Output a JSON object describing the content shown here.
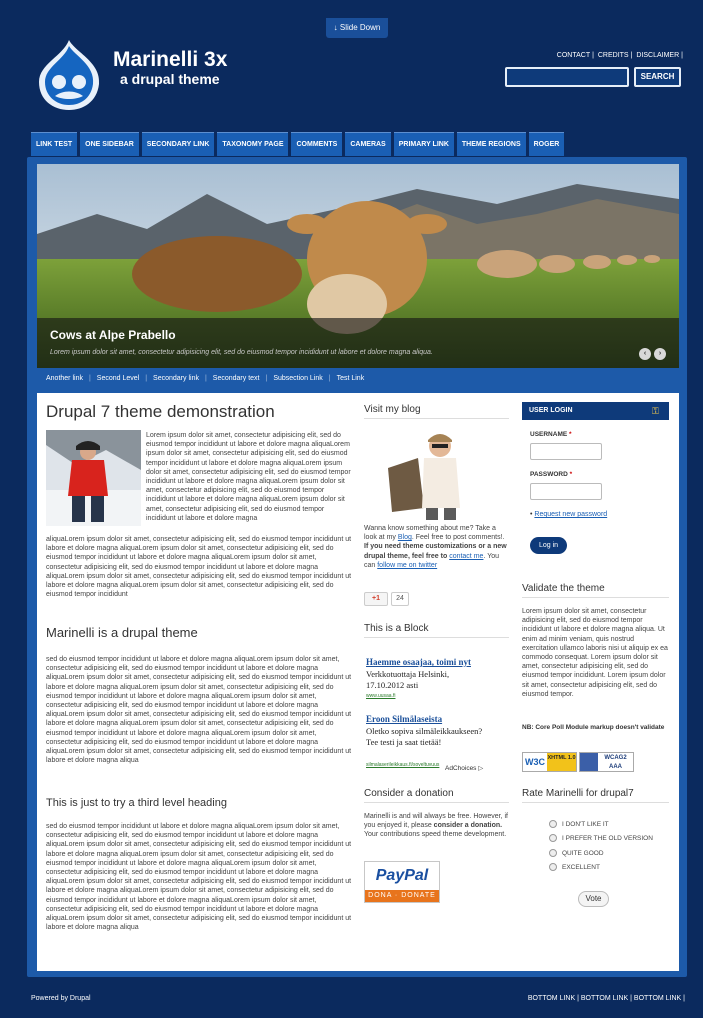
{
  "header": {
    "slide_down": "↓ Slide Down",
    "site_name": "Marinelli 3x",
    "site_slogan": "a drupal theme",
    "top_links": [
      "CONTACT",
      "CREDITS",
      "DISCLAIMER"
    ],
    "search_button": "SEARCH"
  },
  "primary_menu": [
    "LINK TEST",
    "ONE SIDEBAR",
    "SECONDARY LINK",
    "TAXONOMY PAGE",
    "COMMENTS",
    "CAMERAS",
    "PRIMARY LINK",
    "THEME REGIONS",
    "ROGER"
  ],
  "banner": {
    "title": "Cows at Alpe Prabello",
    "text": "Lorem ipsum dolor sit amet, consectetur adipisicing elit, sed do eiusmod tempor incididunt ut labore et dolore magna aliqua.",
    "prev": "‹",
    "next": "›"
  },
  "secondary_menu": [
    "Another link",
    "Second Level",
    "Secondary link",
    "Secondary text",
    "Subsection Link",
    "Test Link"
  ],
  "main": {
    "title": "Drupal 7 theme demonstration",
    "intro_wrap": "Lorem ipsum dolor sit amet, consectetur adipisicing elit, sed do eiusmod tempor incididunt ut labore et dolore magna aliquaLorem ipsum dolor sit amet, consectetur adipisicing elit, sed do eiusmod tempor incididunt ut labore et dolore magna aliquaLorem ipsum dolor sit amet, consectetur adipisicing elit, sed do eiusmod tempor incididunt ut labore et dolore magna aliquaLorem ipsum dolor sit amet, consectetur adipisicing elit, sed do eiusmod tempor incididunt ut labore et dolore magna aliquaLorem ipsum dolor sit amet, consectetur adipisicing elit, sed do eiusmod tempor incididunt ut labore et dolore magna",
    "intro_rest": "aliquaLorem ipsum dolor sit amet, consectetur adipisicing elit, sed do eiusmod tempor incididunt ut labore et dolore magna aliquaLorem ipsum dolor sit amet, consectetur adipisicing elit, sed do eiusmod tempor incididunt ut labore et dolore magna aliquaLorem ipsum dolor sit amet, consectetur adipisicing elit, sed do eiusmod tempor incididunt ut labore et dolore magna aliquaLorem ipsum dolor sit amet, consectetur adipisicing elit, sed do eiusmod tempor incididunt ut labore et dolore magna aliquaLorem ipsum dolor sit amet, consectetur adipisicing elit, sed do eiusmod tempor incididunt",
    "h2": "Marinelli is a drupal theme",
    "p2": "sed do eiusmod tempor incididunt ut labore et dolore magna aliquaLorem ipsum dolor sit amet, consectetur adipisicing elit, sed do eiusmod tempor incididunt ut labore et dolore magna aliquaLorem ipsum dolor sit amet, consectetur adipisicing elit, sed do eiusmod tempor incididunt ut labore et dolore magna aliquaLorem ipsum dolor sit amet, consectetur adipisicing elit, sed do eiusmod tempor incididunt ut labore et dolore magna aliquaLorem ipsum dolor sit amet, consectetur adipisicing elit, sed do eiusmod tempor incididunt ut labore et dolore magna aliquaLorem ipsum dolor sit amet, consectetur adipisicing elit, sed do eiusmod tempor incididunt ut labore et dolore magna aliquaLorem ipsum dolor sit amet, consectetur adipisicing elit, sed do eiusmod tempor incididunt ut labore et dolore magna aliquaLorem ipsum dolor sit amet, consectetur adipisicing elit, sed do eiusmod tempor incididunt ut labore et dolore magna aliquaLorem ipsum dolor sit amet, consectetur adipisicing elit, sed do eiusmod tempor incididunt ut labore et dolore magna aliqua",
    "h3": "This is just to try a third level heading",
    "p3": "sed do eiusmod tempor incididunt ut labore et dolore magna aliquaLorem ipsum dolor sit amet, consectetur adipisicing elit, sed do eiusmod tempor incididunt ut labore et dolore magna aliquaLorem ipsum dolor sit amet, consectetur adipisicing elit, sed do eiusmod tempor incididunt ut labore et dolore magna aliquaLorem ipsum dolor sit amet, consectetur adipisicing elit, sed do eiusmod tempor incididunt ut labore et dolore magna aliquaLorem ipsum dolor sit amet, consectetur adipisicing elit, sed do eiusmod tempor incididunt ut labore et dolore magna aliquaLorem ipsum dolor sit amet, consectetur adipisicing elit, sed do eiusmod tempor incididunt ut labore et dolore magna aliquaLorem ipsum dolor sit amet, consectetur adipisicing elit, sed do eiusmod tempor incididunt ut labore et dolore magna aliquaLorem ipsum dolor sit amet, consectetur adipisicing elit, sed do eiusmod tempor incididunt ut labore et dolore magna aliquaLorem ipsum dolor sit amet, consectetur adipisicing elit, sed do eiusmod tempor incididunt ut labore et dolore magna aliqua"
  },
  "blog": {
    "title": "Visit my blog",
    "t1": "Wanna know something about me? Take a look at my ",
    "blog_link": "Blog",
    "t2": ". Feel free to post comments!. ",
    "bold": "If you need theme customizations or a new drupal theme, feel free to ",
    "contact_link": "contact me",
    "t3": ". You can ",
    "twitter_link": "follow me on twitter",
    "gplus": "+1",
    "gplus_count": "24"
  },
  "ad_block": {
    "title": "This is a Block",
    "ad1_title": "Haemme osaajaa, toimi nyt",
    "ad1_text": "Verkkotuottaja Helsinki, 17.10.2012 asti",
    "ad1_url": "www.uusaa.fi",
    "ad2_title": "Eroon Silmälaseista",
    "ad2_text": "Oletko sopiva silmäleikkaukseen? Tee testi ja saat tietää!",
    "ad2_url": "silmalaserileikkaus.fi/soveltuvuus",
    "adchoices": "AdChoices ▷"
  },
  "donation": {
    "title": "Consider a donation",
    "t1": "Marinelli is and will always be free. However, if you enjoyed it, please ",
    "bold": "consider a donation.",
    "t2": " Your contributions speed theme development.",
    "paypal_logo": "PayPal",
    "paypal_btn": "DONA · DONATE"
  },
  "login": {
    "title": "USER LOGIN",
    "username_label": "USERNAME",
    "password_label": "PASSWORD",
    "required": "*",
    "request_password": "Request new password",
    "button": "Log in"
  },
  "validate": {
    "title": "Validate the theme",
    "text": "Lorem ipsum dolor sit amet, consectetur adipisicing elit, sed do eiusmod tempor incididunt ut labore et dolore magna aliqua. Ut enim ad minim veniam, quis nostrud exercitation ullamco laboris nisi ut aliquip ex ea commodo consequat. Lorem ipsum dolor sit amet, consectetur adipisicing elit, sed do eiusmod tempor incididunt. Lorem ipsum dolor sit amet, consectetur adipisicing elit, sed do eiusmod tempor.",
    "note": "NB: Core Poll Module markup doesn't validate",
    "badge1_a": "W3C",
    "badge1_b": "XHTML 1.0",
    "badge2": "WCAG2 AAA"
  },
  "poll": {
    "title": "Rate Marinelli for drupal7",
    "options": [
      "I DON'T LIKE IT",
      "I PREFER THE OLD VERSION",
      "QUITE GOOD",
      "EXCELLENT"
    ],
    "vote": "Vote"
  },
  "footer": {
    "powered": "Powered by Drupal",
    "links": [
      "BOTTOM LINK",
      "BOTTOM LINK",
      "BOTTOM LINK"
    ]
  },
  "colors": {
    "page_bg": "#0b2a5e",
    "menu_bg": "#1a5fb4",
    "frame_bg": "#1d5aa9",
    "accent_dark": "#0e3a7a"
  }
}
